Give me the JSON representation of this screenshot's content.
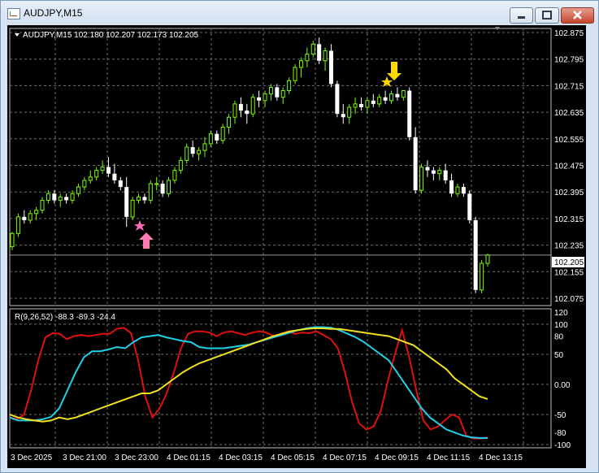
{
  "window": {
    "title": "AUDJPY,M15"
  },
  "main_chart": {
    "header": "AUDJPY,M15  102.180 102.207 102.173 102.205",
    "current_price": "102.205",
    "price_ticks": [
      "102.875",
      "102.795",
      "102.715",
      "102.635",
      "102.555",
      "102.475",
      "102.395",
      "102.315",
      "102.235",
      "102.155",
      "102.075"
    ],
    "price_range": [
      102.075,
      102.875
    ],
    "price_line_value": 102.205,
    "up_color": "#7cfc00",
    "down_color": "#ffffff",
    "grid": true
  },
  "indicator": {
    "header": "R(9,26,52) -88.3 -89.3 -24.4",
    "ticks": [
      "120",
      "100",
      "80",
      "50",
      "0.00",
      "-50",
      "-80",
      "-100"
    ],
    "range": [
      -100,
      120
    ],
    "series_colors": [
      "#e01010",
      "#20d0e8",
      "#f0e020"
    ]
  },
  "time_axis": {
    "labels": [
      "3 Dec 2025",
      "3 Dec 21:00",
      "3 Dec 23:00",
      "4 Dec 01:15",
      "4 Dec 03:15",
      "4 Dec 05:15",
      "4 Dec 07:15",
      "4 Dec 09:15",
      "4 Dec 11:15",
      "4 Dec 13:15"
    ]
  },
  "markers": {
    "buy_arrow_color": "#ff7bb0",
    "sell_arrow_color": "#ffd700",
    "buy_star_color": "#ff69b4",
    "sell_star_color": "#ffd700"
  },
  "chart_data": {
    "type": "candlestick",
    "x": [
      "3 Dec 2025",
      "3 Dec 21:00",
      "3 Dec 23:00",
      "4 Dec 01:15",
      "4 Dec 03:15",
      "4 Dec 05:15",
      "4 Dec 07:15",
      "4 Dec 09:15",
      "4 Dec 11:15",
      "4 Dec 13:15"
    ],
    "ylim": [
      102.075,
      102.875
    ],
    "ohlc": [
      [
        102.23,
        102.275,
        102.22,
        102.27
      ],
      [
        102.27,
        102.33,
        102.26,
        102.32
      ],
      [
        102.32,
        102.34,
        102.3,
        102.31
      ],
      [
        102.31,
        102.34,
        102.3,
        102.33
      ],
      [
        102.33,
        102.35,
        102.31,
        102.34
      ],
      [
        102.34,
        102.38,
        102.33,
        102.37
      ],
      [
        102.37,
        102.4,
        102.36,
        102.39
      ],
      [
        102.39,
        102.4,
        102.36,
        102.37
      ],
      [
        102.37,
        102.39,
        102.35,
        102.38
      ],
      [
        102.38,
        102.39,
        102.36,
        102.37
      ],
      [
        102.37,
        102.4,
        102.36,
        102.39
      ],
      [
        102.39,
        102.42,
        102.38,
        102.41
      ],
      [
        102.41,
        102.44,
        102.4,
        102.43
      ],
      [
        102.43,
        102.46,
        102.42,
        102.44
      ],
      [
        102.44,
        102.47,
        102.43,
        102.46
      ],
      [
        102.46,
        102.49,
        102.45,
        102.47
      ],
      [
        102.47,
        102.5,
        102.44,
        102.45
      ],
      [
        102.45,
        102.48,
        102.42,
        102.43
      ],
      [
        102.43,
        102.44,
        102.4,
        102.41
      ],
      [
        102.41,
        102.44,
        102.29,
        102.32
      ],
      [
        102.32,
        102.38,
        102.31,
        102.37
      ],
      [
        102.37,
        102.39,
        102.36,
        102.38
      ],
      [
        102.38,
        102.39,
        102.36,
        102.37
      ],
      [
        102.37,
        102.43,
        102.36,
        102.42
      ],
      [
        102.42,
        102.44,
        102.4,
        102.42
      ],
      [
        102.42,
        102.43,
        102.38,
        102.39
      ],
      [
        102.39,
        102.44,
        102.38,
        102.43
      ],
      [
        102.43,
        102.47,
        102.42,
        102.46
      ],
      [
        102.46,
        102.5,
        102.45,
        102.49
      ],
      [
        102.49,
        102.54,
        102.48,
        102.53
      ],
      [
        102.53,
        102.55,
        102.5,
        102.51
      ],
      [
        102.51,
        102.53,
        102.49,
        102.52
      ],
      [
        102.52,
        102.56,
        102.5,
        102.54
      ],
      [
        102.54,
        102.58,
        102.53,
        102.57
      ],
      [
        102.57,
        102.58,
        102.54,
        102.55
      ],
      [
        102.55,
        102.6,
        102.54,
        102.59
      ],
      [
        102.59,
        102.63,
        102.57,
        102.62
      ],
      [
        102.62,
        102.67,
        102.6,
        102.66
      ],
      [
        102.66,
        102.68,
        102.62,
        102.64
      ],
      [
        102.64,
        102.66,
        102.6,
        102.63
      ],
      [
        102.63,
        102.69,
        102.62,
        102.68
      ],
      [
        102.68,
        102.7,
        102.65,
        102.67
      ],
      [
        102.67,
        102.7,
        102.65,
        102.69
      ],
      [
        102.69,
        102.72,
        102.67,
        102.71
      ],
      [
        102.71,
        102.72,
        102.67,
        102.68
      ],
      [
        102.68,
        102.71,
        102.66,
        102.7
      ],
      [
        102.7,
        102.74,
        102.69,
        102.73
      ],
      [
        102.73,
        102.78,
        102.72,
        102.77
      ],
      [
        102.77,
        102.8,
        102.74,
        102.79
      ],
      [
        102.79,
        102.83,
        102.77,
        102.81
      ],
      [
        102.81,
        102.85,
        102.8,
        102.84
      ],
      [
        102.84,
        102.86,
        102.78,
        102.79
      ],
      [
        102.79,
        102.83,
        102.76,
        102.82
      ],
      [
        102.82,
        102.84,
        102.71,
        102.72
      ],
      [
        102.72,
        102.73,
        102.62,
        102.63
      ],
      [
        102.63,
        102.66,
        102.6,
        102.62
      ],
      [
        102.62,
        102.66,
        102.6,
        102.65
      ],
      [
        102.65,
        102.68,
        102.63,
        102.66
      ],
      [
        102.66,
        102.68,
        102.64,
        102.65
      ],
      [
        102.65,
        102.68,
        102.63,
        102.67
      ],
      [
        102.67,
        102.69,
        102.65,
        102.66
      ],
      [
        102.66,
        102.69,
        102.65,
        102.68
      ],
      [
        102.68,
        102.7,
        102.66,
        102.67
      ],
      [
        102.67,
        102.7,
        102.66,
        102.69
      ],
      [
        102.69,
        102.71,
        102.67,
        102.68
      ],
      [
        102.68,
        102.7,
        102.67,
        102.7
      ],
      [
        102.7,
        102.71,
        102.55,
        102.56
      ],
      [
        102.56,
        102.59,
        102.39,
        102.4
      ],
      [
        102.4,
        102.48,
        102.39,
        102.47
      ],
      [
        102.47,
        102.49,
        102.44,
        102.46
      ],
      [
        102.46,
        102.47,
        102.43,
        102.45
      ],
      [
        102.45,
        102.47,
        102.43,
        102.46
      ],
      [
        102.46,
        102.48,
        102.42,
        102.43
      ],
      [
        102.43,
        102.45,
        102.38,
        102.39
      ],
      [
        102.39,
        102.42,
        102.38,
        102.41
      ],
      [
        102.41,
        102.42,
        102.38,
        102.39
      ],
      [
        102.39,
        102.4,
        102.3,
        102.31
      ],
      [
        102.31,
        102.32,
        102.09,
        102.1
      ],
      [
        102.1,
        102.19,
        102.09,
        102.18
      ],
      [
        102.18,
        102.21,
        102.17,
        102.205
      ]
    ],
    "indicator_series": [
      {
        "values": [
          -55,
          -58,
          -50,
          -10,
          40,
          78,
          85,
          84,
          75,
          80,
          82,
          80,
          82,
          84,
          84,
          92,
          94,
          85,
          40,
          -20,
          -55,
          -40,
          -15,
          20,
          60,
          84,
          88,
          88,
          86,
          80,
          86,
          88,
          85,
          82,
          86,
          88,
          86,
          80,
          84,
          88,
          84,
          86,
          85,
          88,
          82,
          75,
          60,
          20,
          -30,
          -65,
          -75,
          -70,
          -45,
          5,
          50,
          90,
          45,
          -10,
          -60,
          -75,
          -70,
          -60,
          -50,
          -55,
          -85,
          -90,
          -90,
          -88.3
        ]
      },
      {
        "values": [
          -55,
          -60,
          -60,
          -60,
          -58,
          -54,
          -40,
          -10,
          20,
          45,
          55,
          55,
          58,
          62,
          60,
          70,
          78,
          80,
          82,
          78,
          75,
          72,
          70,
          62,
          60,
          60,
          60,
          62,
          64,
          66,
          70,
          74,
          78,
          82,
          86,
          90,
          93,
          95,
          95,
          94,
          90,
          84,
          78,
          70,
          60,
          50,
          40,
          20,
          0,
          -20,
          -40,
          -55,
          -65,
          -75,
          -80,
          -85,
          -88,
          -89,
          -89.3
        ]
      },
      {
        "values": [
          -50,
          -55,
          -58,
          -60,
          -62,
          -60,
          -55,
          -58,
          -55,
          -50,
          -45,
          -40,
          -35,
          -30,
          -25,
          -20,
          -15,
          -15,
          -10,
          0,
          10,
          20,
          28,
          35,
          40,
          45,
          50,
          55,
          60,
          65,
          70,
          75,
          80,
          84,
          88,
          90,
          92,
          93,
          93,
          92,
          92,
          90,
          88,
          86,
          84,
          82,
          80,
          75,
          70,
          65,
          55,
          45,
          35,
          25,
          10,
          0,
          -10,
          -20,
          -24.4
        ]
      }
    ]
  }
}
